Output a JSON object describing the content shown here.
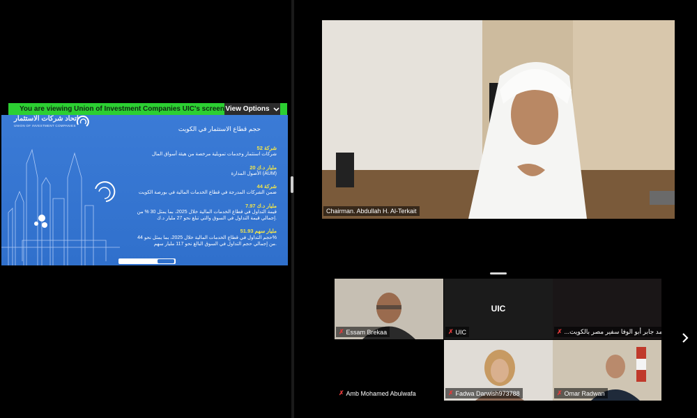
{
  "share_banner": {
    "viewing_text": "You are viewing  Union of Investment Companies UIC's screen",
    "view_options_label": "View Options",
    "chevron_icon": "chevron-down-icon"
  },
  "slide": {
    "logo_ar": "اتحاد شركات الاستثمار",
    "logo_en": "UNION OF INVESTMENT COMPANIES",
    "title": "حجم قطاع الاستثمار في الكويت",
    "stats": [
      {
        "headline": "52 شركة",
        "body": [
          "شركات استثمار وخدمات تمويلية مرخصة من هيئة أسواق المال"
        ]
      },
      {
        "headline": "20 مليار د.ك",
        "body": [
          "الأصول المدارة (AUM)"
        ]
      },
      {
        "headline": "44 شركة",
        "body": [
          "ضمن الشركات المدرجة في قطاع الخدمات المالية في بورصة الكويت"
        ]
      },
      {
        "headline": "7.97 مليار د.ك",
        "body": [
          "قيمة التداول في قطاع الخدمات المالية خلال 2025، بما يمثل 30 % من",
          "إجمالي قيمة التداول في السوق والتي تبلغ نحو 27 مليار د.ك."
        ]
      },
      {
        "headline": "51.93 مليار سهم",
        "body": [
          "حجم التداول في قطاع الخدمات المالية خلال 2025، بما يمثل نحو 44%",
          "من إجمالي حجم التداول في السوق البالغ نحو 117 مليار سهم."
        ]
      }
    ]
  },
  "speaker": {
    "name": "Chairman. Abdullah H. Al-Terkait"
  },
  "gallery": [
    {
      "name": "Essam Brekaa",
      "muted": true,
      "has_video": true
    },
    {
      "name": "UIC",
      "muted": true,
      "has_video": false,
      "initials": "UIC"
    },
    {
      "name": "...ير محمد جابر أبو الوفا سفير مصر بالكويت",
      "muted": true,
      "has_video": false
    },
    {
      "name": "Amb Mohamed Abulwafa",
      "muted": true,
      "has_video": false
    },
    {
      "name": "Fadwa Darwish973788",
      "muted": true,
      "has_video": true
    },
    {
      "name": "Omar Radwan",
      "muted": true,
      "has_video": true
    }
  ],
  "icons": {
    "mute": "mic-muted-icon",
    "next": "chevron-right-icon"
  }
}
